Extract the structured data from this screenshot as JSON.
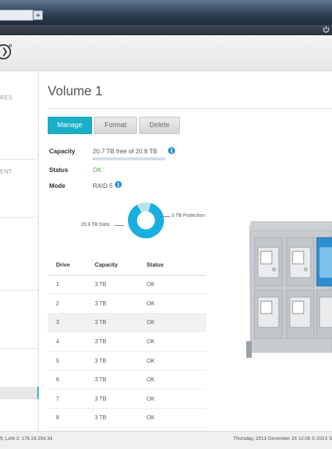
{
  "browser": {
    "new_tab": "+"
  },
  "sidebar": {
    "sections": [
      "RES",
      "ENT"
    ]
  },
  "volume": {
    "title": "Volume 1",
    "buttons": {
      "manage": "Manage",
      "format": "Format",
      "delete": "Delete"
    },
    "capacity_label": "Capacity",
    "capacity_value": "20.7 TB free of 20.8 TB",
    "capacity_used_fraction": 0.005,
    "status_label": "Status",
    "status_value": "OK",
    "mode_label": "Mode",
    "mode_value": "RAID 5",
    "info_glyph": "i"
  },
  "chart_data": {
    "type": "pie",
    "categories": [
      "20.8 TB Data",
      "3 TB Protection"
    ],
    "values": [
      20.8,
      3
    ],
    "colors": [
      "#17b0e0",
      "#b8e3f0"
    ]
  },
  "drives": {
    "headers": {
      "drive": "Drive",
      "capacity": "Capacity",
      "status": "Status"
    },
    "rows": [
      {
        "drive": "1",
        "capacity": "3 TB",
        "status": "OK"
      },
      {
        "drive": "2",
        "capacity": "3 TB",
        "status": "OK"
      },
      {
        "drive": "3",
        "capacity": "3 TB",
        "status": "OK"
      },
      {
        "drive": "4",
        "capacity": "3 TB",
        "status": "OK"
      },
      {
        "drive": "5",
        "capacity": "3 TB",
        "status": "OK"
      },
      {
        "drive": "6",
        "capacity": "3 TB",
        "status": "OK"
      },
      {
        "drive": "7",
        "capacity": "3 TB",
        "status": "OK"
      },
      {
        "drive": "8",
        "capacity": "3 TB",
        "status": "OK"
      }
    ]
  },
  "footer": {
    "network": "5; LAN 2: 176.16.254.34",
    "datetime": "Thursday, 2013 December 26   12:06   © 2013 S"
  },
  "colors": {
    "accent": "#17b0c8",
    "ok": "#4cae4c",
    "info": "#1e8fd8"
  },
  "icons": {
    "power": "power-icon",
    "logo": "logo-icon",
    "info": "info-icon"
  }
}
